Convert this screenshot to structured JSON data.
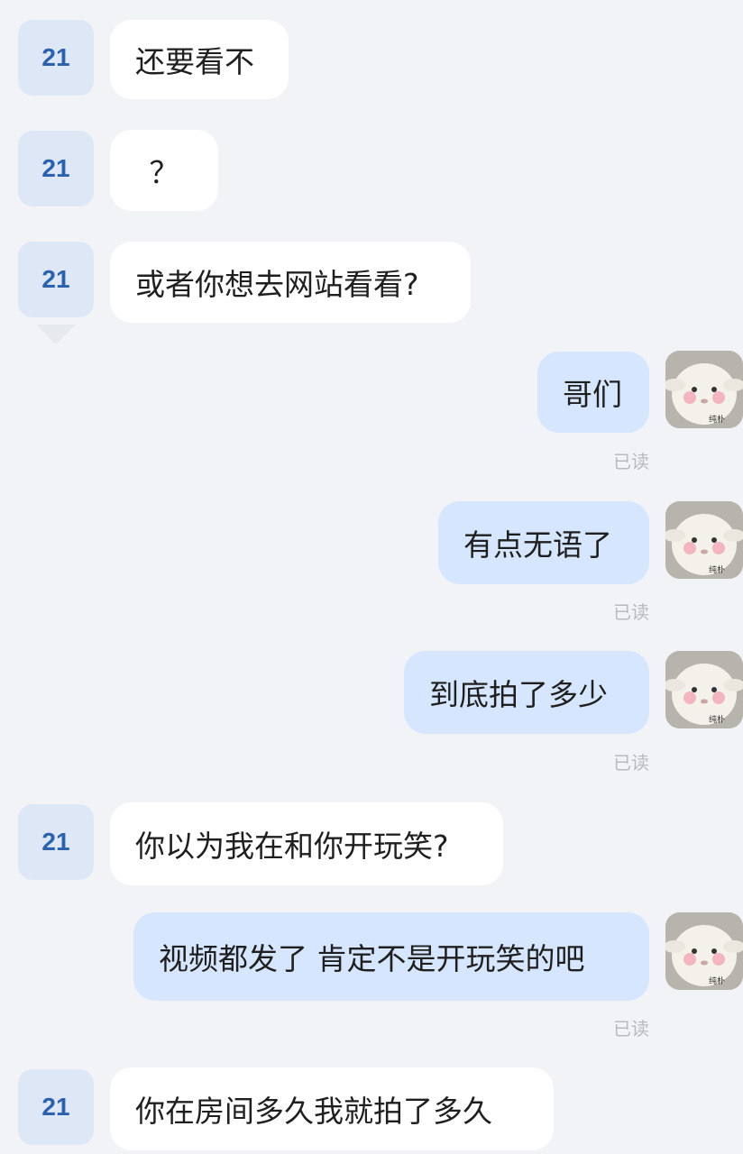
{
  "contact": {
    "avatar_label": "21"
  },
  "me": {
    "avatar_caption": "纯朴"
  },
  "messages": [
    {
      "from": "them",
      "text": "还要看不"
    },
    {
      "from": "them",
      "text": "？"
    },
    {
      "from": "them",
      "text": "或者你想去网站看看?"
    },
    {
      "from": "me",
      "text": "哥们",
      "status": "已读"
    },
    {
      "from": "me",
      "text": "有点无语了",
      "status": "已读"
    },
    {
      "from": "me",
      "text": "到底拍了多少",
      "status": "已读"
    },
    {
      "from": "them",
      "text": "你以为我在和你开玩笑?"
    },
    {
      "from": "me",
      "text": "视频都发了 肯定不是开玩笑的吧",
      "status": "已读"
    },
    {
      "from": "them",
      "text": "你在房间多久我就拍了多久"
    }
  ],
  "colors": {
    "background": "#f1f3f6",
    "incoming_bubble": "#ffffff",
    "outgoing_bubble": "#d6e6ff",
    "contact_avatar_bg": "#dde7f6",
    "contact_avatar_text": "#2c62ad",
    "read_status": "#b7bac0"
  }
}
